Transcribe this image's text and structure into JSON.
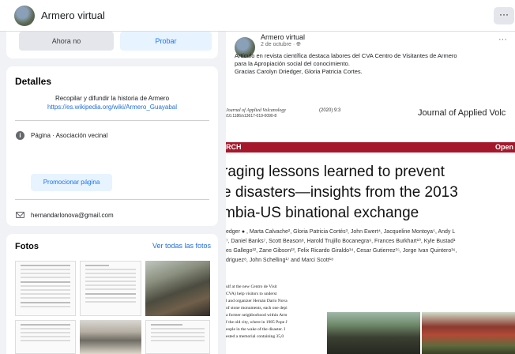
{
  "header": {
    "page_name": "Armero virtual",
    "more_label": "···"
  },
  "actions": {
    "no_label": "Ahora no",
    "try_label": "Probar"
  },
  "details": {
    "heading": "Detalles",
    "description": "Recopilar y difundir la historia de Armero",
    "link": "https://es.wikipedia.org/wiki/Armero_Guayabal",
    "page_type": "Página · Asociación vecinal",
    "promote_label": "Promocionar página",
    "email": "hernandarlonova@gmail.com",
    "info_icon": "info-icon",
    "mail_icon": "mail-icon"
  },
  "photos": {
    "heading": "Fotos",
    "see_all": "Ver todas las fotos"
  },
  "post": {
    "author": "Armero virtual",
    "date": "2 de octubre · ",
    "globe": "globe-icon",
    "more": "···",
    "text_line1": "Artículo en revista científica destaca labores del CVA Centro de Visitantes de Armero",
    "text_line2": "para la Apropiación social del conocimiento.",
    "text_line3": "Gracias Carolyn Driedger, Gloria Patricia Cortes."
  },
  "article": {
    "journal_small": "Journal of Applied Volcanology",
    "year": "(2020) 9:3",
    "doi": "/10.1186/s13617-019-0090-8",
    "journal_big": "Journal of Applied Volc",
    "banner_left": "RCH",
    "banner_right": "Open",
    "headline_1": "raging lessons learned to prevent",
    "headline_2": "e disasters—insights from the 2013",
    "headline_3": "mbia-US binational exchange",
    "authors_1": "edger ● , Marta Calvache², Gloria Patricia Cortés³, John Ewert⁴, Jacqueline Montoya⁵, Andy L",
    "authors_2": "⁷, Daniel Banks⁷, Scott Beason⁸, Harold Trujillo Bocanegra⁹, Frances Burkhart¹⁰, Kyle Bustad¹",
    "authors_3": "es Gallego¹², Zane Gibson¹³, Felix Ricardo Giraldo¹⁴, Cesar Gutierrez¹⁵, Jorge Ivan Quintero¹⁶,",
    "authors_4": "driguez⁸, John Schelling¹⁷ and Marci Scott¹⁸",
    "body_1": "ulf at the new Centro de Visit",
    "body_2": "CVA) help visitors to underst",
    "body_3": "l and organizer Hernán Darío Nova",
    "body_4": "of stone monuments, each one depi",
    "body_5": "a former neighborhood within Arm",
    "body_6": "f the old city, where in 1985 Pope J",
    "body_7": "eople in the wake of the disaster. I",
    "body_8": "ested a memorial containing 35,0"
  }
}
